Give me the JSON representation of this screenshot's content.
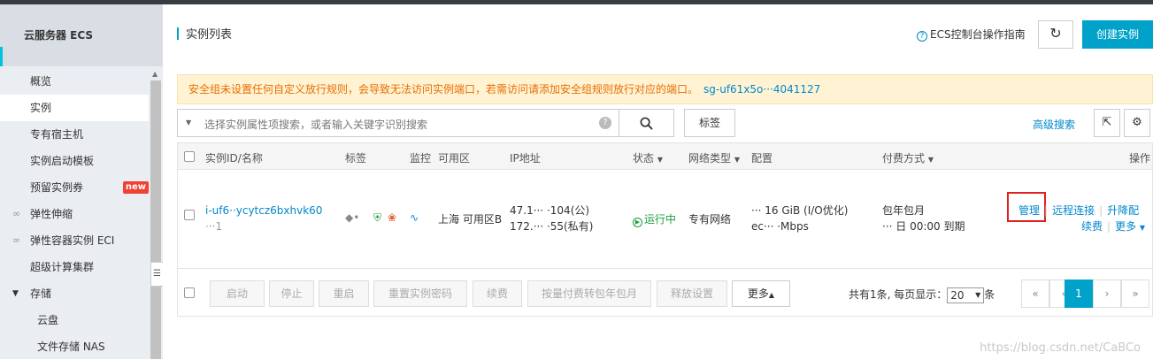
{
  "sidebar": {
    "title": "云服务器 ECS",
    "items": [
      {
        "label": "概览"
      },
      {
        "label": "实例"
      },
      {
        "label": "专有宿主机"
      },
      {
        "label": "实例启动模板"
      },
      {
        "label": "预留实例券",
        "badge": "new"
      },
      {
        "label": "弹性伸缩"
      },
      {
        "label": "弹性容器实例 ECI"
      },
      {
        "label": "超级计算集群"
      },
      {
        "label": "存储"
      },
      {
        "label": "云盘"
      },
      {
        "label": "文件存储 NAS"
      }
    ]
  },
  "header": {
    "title": "实例列表",
    "guide": "ECS控制台操作指南",
    "create": "创建实例"
  },
  "warning": {
    "text": "安全组未设置任何自定义放行规则，会导致无法访问实例端口，若需访问请添加安全组规则放行对应的端口。",
    "sg_id": "sg-uf61x5o···4041127"
  },
  "search": {
    "placeholder": "选择实例属性项搜索，或者输入关键字识别搜索",
    "tag_button": "标签",
    "advanced": "高级搜索"
  },
  "table": {
    "headers": [
      "实例ID/名称",
      "标签",
      "监控",
      "可用区",
      "IP地址",
      "状态",
      "网络类型",
      "配置",
      "付费方式",
      "操作"
    ],
    "row": {
      "id": "i-uf6··ycytcz6bxhvk60",
      "name": "···1",
      "zone": "上海 可用区B",
      "ip_public": "47.1··· ·104(公)",
      "ip_private": "172.··· ·55(私有)",
      "status": "运行中",
      "network": "专有网络",
      "config_line1": "··· 16 GiB (I/O优化)",
      "config_line2": "ec··· ·Mbps",
      "billing_type": "包年包月",
      "expire": "··· 日 00:00 到期",
      "actions": [
        "管理",
        "远程连接",
        "升降配",
        "续费",
        "更多"
      ]
    }
  },
  "footer": {
    "buttons": [
      "启动",
      "停止",
      "重启",
      "重置实例密码",
      "续费",
      "按量付费转包年包月",
      "释放设置"
    ],
    "more": "更多",
    "total_prefix": "共有1条, 每页显示：",
    "page_size": "20",
    "total_suffix": "条",
    "pages": [
      "«",
      "‹",
      "1",
      "›",
      "»"
    ]
  },
  "watermark": "https://blog.csdn.net/CaBCo"
}
